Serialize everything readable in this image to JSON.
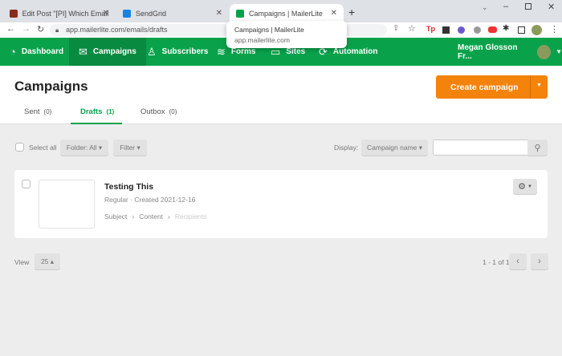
{
  "browser": {
    "tabs": [
      {
        "title": "Edit Post \"[PI] Which Email Marke",
        "color": "#8b2a1a"
      },
      {
        "title": "SendGrid",
        "color": "#1a82e2"
      },
      {
        "title": "Campaigns | MailerLite",
        "color": "#09a24b"
      }
    ],
    "url": "app.mailerlite.com/emails/drafts",
    "tooltip": {
      "title": "Campaigns | MailerLite",
      "url": "app.mailerlite.com"
    }
  },
  "nav": {
    "items": [
      "Dashboard",
      "Campaigns",
      "Subscribers",
      "Forms",
      "Sites",
      "Automation"
    ],
    "user": "Megan Glosson Fr..."
  },
  "page": {
    "title": "Campaigns",
    "create_label": "Create campaign",
    "tabs": [
      {
        "label": "Sent",
        "count": "(0)"
      },
      {
        "label": "Drafts",
        "count": "(1)"
      },
      {
        "label": "Outbox",
        "count": "(0)"
      }
    ]
  },
  "toolbar": {
    "select_all": "Select all",
    "folder": "Folder: All ▾",
    "filter": "Filter ▾",
    "display_label": "Display:",
    "display_value": "Campaign name ▾",
    "search_placeholder": ""
  },
  "campaign": {
    "name": "Testing This",
    "meta": "Regular · Created 2021-12-16",
    "steps": [
      "Subject",
      "Content",
      "Recipients"
    ]
  },
  "pagination": {
    "view_label": "View",
    "per_page": "25 ▴",
    "range": "1 - 1 of 1"
  },
  "colors": {
    "green": "#09a24b",
    "orange": "#f4830c"
  }
}
